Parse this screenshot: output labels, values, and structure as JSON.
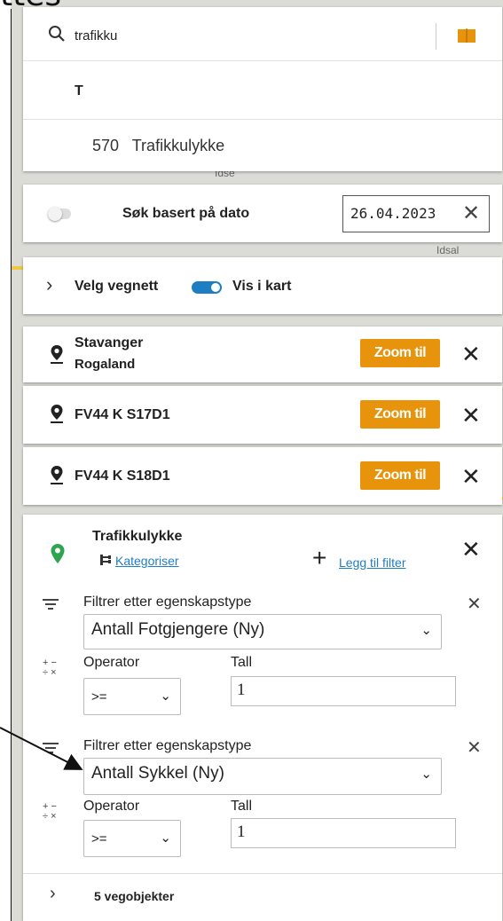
{
  "window_title_fragment": "ttes",
  "search": {
    "value": "trafikku"
  },
  "suggestions": {
    "group_letter": "T",
    "items": [
      {
        "code": "570",
        "label": "Trafikkulykke"
      }
    ]
  },
  "date_filter": {
    "label": "Søk basert på dato",
    "value": "26.04.2023",
    "toggle_on": false
  },
  "vegnett": {
    "label": "Velg vegnett",
    "map_label": "Vis i kart",
    "toggle_on": true
  },
  "map_labels": {
    "idse": "Idse",
    "idsal": "Idsal"
  },
  "locations": [
    {
      "name": "Stavanger",
      "sub": "Rogaland",
      "zoom_label": "Zoom til"
    },
    {
      "name": "FV44 K S17D1",
      "sub": "",
      "zoom_label": "Zoom til"
    },
    {
      "name": "FV44 K S18D1",
      "sub": "",
      "zoom_label": "Zoom til"
    }
  ],
  "object_type": {
    "title": "Trafikkulykke",
    "categorize_label": "Kategoriser",
    "add_filter_label": "Legg til filter",
    "filters": [
      {
        "header": "Filtrer etter egenskapstype",
        "property": "Antall Fotgjengere (Ny)",
        "operator_label": "Operator",
        "operator": ">=",
        "value_label": "Tall",
        "value": "1"
      },
      {
        "header": "Filtrer etter egenskapstype",
        "property": "Antall Sykkel (Ny)",
        "operator_label": "Operator",
        "operator": ">=",
        "value_label": "Tall",
        "value": "1"
      }
    ]
  },
  "results": {
    "label": "5 vegobjekter"
  },
  "colors": {
    "accent_blue": "#1f7ec2",
    "zoom_orange": "#e8930c",
    "pin_green": "#2ea44f",
    "book_orange": "#e8930c"
  }
}
